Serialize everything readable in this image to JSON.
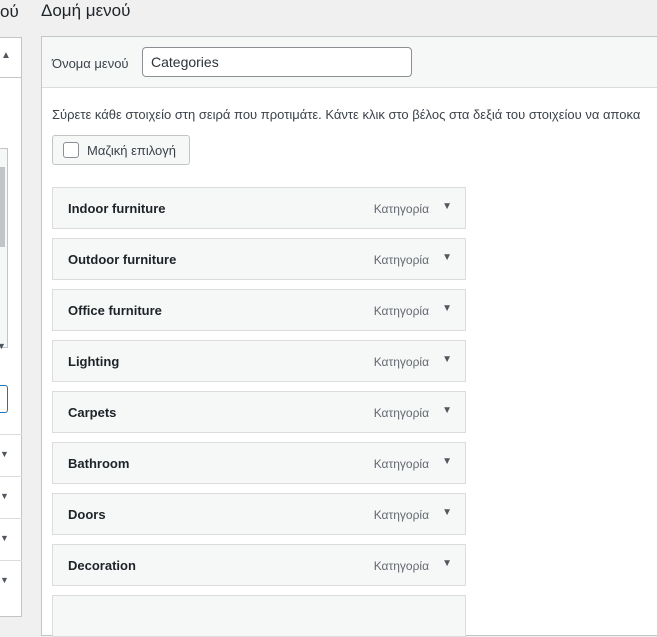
{
  "left": {
    "title_fragment": "ού"
  },
  "header": {
    "title": "Δομή μενού"
  },
  "menu_name": {
    "label": "Όνομα μενού",
    "value": "Categories"
  },
  "instructions": "Σύρετε κάθε στοιχείο στη σειρά που προτιμάτε. Κάντε κλικ στο βέλος στα δεξιά του στοιχείου να αποκα",
  "bulk_select": {
    "label": "Μαζική επιλογή"
  },
  "items": [
    {
      "title": "Indoor furniture",
      "type": "Κατηγορία"
    },
    {
      "title": "Outdoor furniture",
      "type": "Κατηγορία"
    },
    {
      "title": "Office furniture",
      "type": "Κατηγορία"
    },
    {
      "title": "Lighting",
      "type": "Κατηγορία"
    },
    {
      "title": "Carpets",
      "type": "Κατηγορία"
    },
    {
      "title": "Bathroom",
      "type": "Κατηγορία"
    },
    {
      "title": "Doors",
      "type": "Κατηγορία"
    },
    {
      "title": "Decoration",
      "type": "Κατηγορία"
    },
    {
      "title": "",
      "type": ""
    }
  ]
}
